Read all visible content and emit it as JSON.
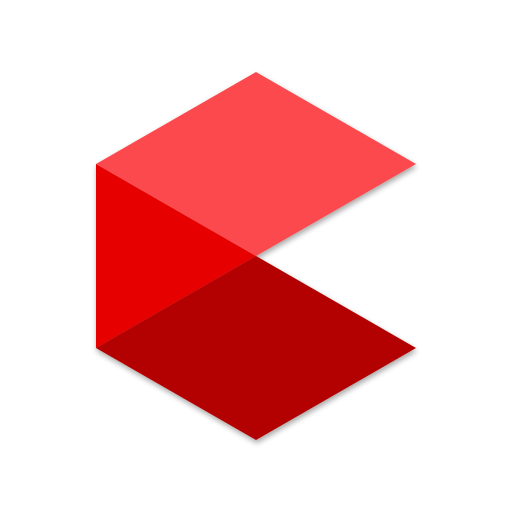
{
  "logo": {
    "name": "red-cube-c-logo",
    "colors": {
      "top_face": "#fb4a4d",
      "left_face": "#e60000",
      "bottom_face": "#b30000",
      "background": "#ffffff"
    }
  }
}
